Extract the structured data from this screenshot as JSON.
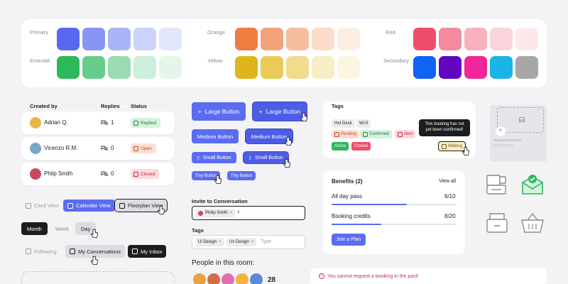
{
  "palette": {
    "groups": [
      {
        "label": "Primary",
        "colors": [
          "#5869f0",
          "#8796f4",
          "#aab5f8",
          "#ccd3fb",
          "#e2e6fd"
        ]
      },
      {
        "label": "Emerald",
        "colors": [
          "#2db85c",
          "#66cd8c",
          "#98dcb0",
          "#cdeedb",
          "#e4f6ea"
        ]
      },
      {
        "label": "Orange",
        "colors": [
          "#ef7c40",
          "#f4a27a",
          "#f7bd9f",
          "#fbdcca",
          "#fdeee4"
        ]
      },
      {
        "label": "Yellow",
        "colors": [
          "#dfb51c",
          "#e9cc58",
          "#f0dc8c",
          "#f8eec6",
          "#fcf6e0"
        ]
      },
      {
        "label": "Red",
        "colors": [
          "#ef4e6b",
          "#f48a9c",
          "#f7b2be",
          "#fad4da",
          "#fde8eb"
        ]
      },
      {
        "label": "Secondary",
        "colors": [
          "#1163f4",
          "#6306c2",
          "#f2269a",
          "#1ab4e6",
          "#a7a7a7"
        ]
      }
    ]
  },
  "table": {
    "headers": {
      "created_by": "Created by",
      "replies": "Replies",
      "status": "Status"
    },
    "rows": [
      {
        "name": "Adrian Q.",
        "replies": "1",
        "status": "Replied",
        "status_kind": "green",
        "avatar_color": "#e7b54a"
      },
      {
        "name": "Vicenzo R.M.",
        "replies": "0",
        "status": "Open",
        "status_kind": "orange",
        "avatar_color": "#7aa6c8"
      },
      {
        "name": "Philp Smith",
        "replies": "0",
        "status": "Closed",
        "status_kind": "red",
        "avatar_color": "#c94a5e"
      }
    ]
  },
  "views": {
    "card": "Card View",
    "calendar": "Calendar View",
    "floorplan": "Floorplan View",
    "month": "Month",
    "week": "Week",
    "day": "Day",
    "following": "Following",
    "my_conversations": "My Conversations",
    "my_inbox": "My Inbox"
  },
  "buttons": {
    "large": "Large Button",
    "medium": "Medium Button",
    "small": "Small Button",
    "tiny": "Tiny Button"
  },
  "invite": {
    "label": "Invite to Conversation",
    "chip": "Philip Smith",
    "value": "I"
  },
  "tags_input": {
    "label": "Tags",
    "chips": [
      "Ui Design",
      "Ux Design"
    ],
    "placeholder": "Type"
  },
  "people": {
    "title": "People in this room:",
    "count": "28",
    "avatar_colors": [
      "#e8a33c",
      "#d36c4a",
      "#e26fb0",
      "#f0b53c",
      "#5b8ad6"
    ]
  },
  "tags_card": {
    "title": "Tags",
    "plain": [
      "Hot Desk",
      "Wi-fi"
    ],
    "status": [
      {
        "label": "Pending",
        "kind": "orange"
      },
      {
        "label": "Confirmed",
        "kind": "green"
      },
      {
        "label": "Alert",
        "kind": "red"
      }
    ],
    "solid": [
      {
        "label": "Active",
        "color": "#2db85c"
      },
      {
        "label": "Closed",
        "color": "#ef4e6b"
      }
    ],
    "tooltip": "This booking has not yet been confirmed!",
    "waiting": "Waiting"
  },
  "benefits": {
    "title": "Benefits (2)",
    "view_all": "View all",
    "items": [
      {
        "label": "All day pass",
        "value": "6/10",
        "fraction": 0.6
      },
      {
        "label": "Booking credits",
        "value": "8/20",
        "fraction": 0.4
      }
    ],
    "cta": "Join a Plan"
  },
  "toast": {
    "text": "You cannot request a booking in the past!"
  },
  "colors": {
    "accent": "#5c6cf0",
    "dark": "#1d1d1f",
    "success": "#2db85c"
  }
}
